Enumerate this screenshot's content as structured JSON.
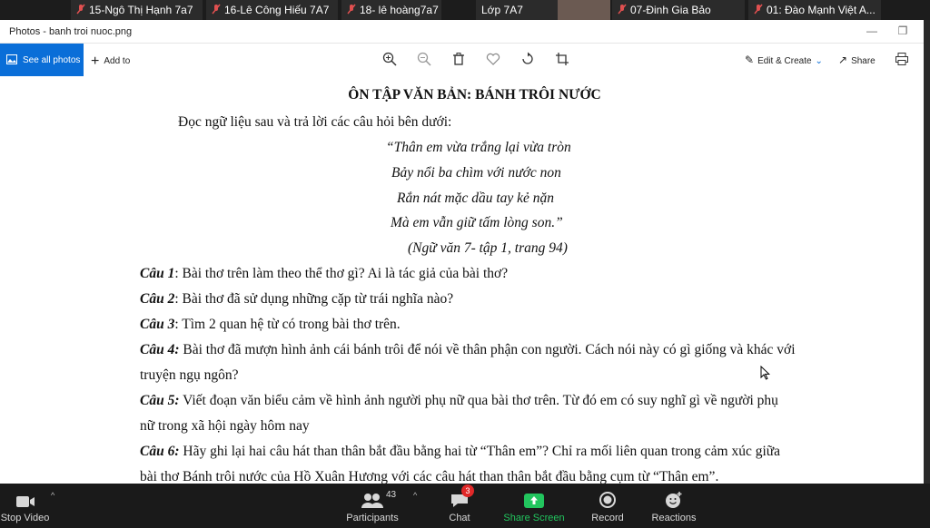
{
  "participants_strip": [
    {
      "name": "15-Ngô Thị Hạnh 7a7",
      "muted": true
    },
    {
      "name": "16-Lê Công Hiếu 7A7",
      "muted": true
    },
    {
      "name": "18- lê hoàng7a7",
      "muted": true
    },
    {
      "name": "Lớp 7A7",
      "muted": false,
      "active": true
    },
    {
      "name": "07-Đinh Gia Bảo",
      "muted": true
    },
    {
      "name": "01: Đào Mạnh Việt A...",
      "muted": true
    }
  ],
  "window": {
    "title": "Photos - banh troi nuoc.png",
    "minimize": "—",
    "restore": "❐"
  },
  "toolbar": {
    "see_all": "See all photos",
    "add_to": "Add to",
    "edit_create": "Edit & Create",
    "share": "Share"
  },
  "document": {
    "title": "ÔN TẬP VĂN BẢN: BÁNH TRÔI NƯỚC",
    "intro": "Đọc ngữ liệu sau và trả lời các câu hỏi bên dưới:",
    "poem": [
      "“Thân em vừa trắng lại vừa tròn",
      "Bảy nổi ba chìm với nước non",
      "Rắn nát mặc dầu tay kẻ nặn",
      "Mà em vẫn giữ tấm lòng son.”",
      "(Ngữ văn 7- tập 1,  trang 94)"
    ],
    "questions": [
      {
        "label": "Câu 1",
        "sep": ": ",
        "lines": [
          "Bài thơ trên làm theo thể thơ gì? Ai là tác giả của bài thơ?"
        ]
      },
      {
        "label": "Câu 2",
        "sep": ": ",
        "lines": [
          "Bài thơ đã sử dụng những cặp từ trái nghĩa nào?"
        ]
      },
      {
        "label": "Câu 3",
        "sep": ": ",
        "lines": [
          "Tìm 2 quan hệ từ có trong bài thơ trên."
        ]
      },
      {
        "label": "Câu 4:",
        "sep": " ",
        "lines": [
          "Bài thơ đã mượn hình ảnh cái bánh trôi để nói về thân phận con người. Cách nói này có gì giống và khác với",
          "truyện ngụ ngôn?"
        ]
      },
      {
        "label": "Câu 5:",
        "sep": " ",
        "lines": [
          "Viết đoạn văn biểu cảm về hình ảnh người phụ nữ qua bài thơ trên. Từ đó em có suy nghĩ gì về người phụ",
          "nữ trong xã hội ngày hôm nay"
        ]
      },
      {
        "label": "Câu 6:",
        "sep": " ",
        "lines": [
          "Hãy ghi lại hai câu hát than thân bắt đầu bằng hai từ “Thân em”? Chỉ ra mối liên quan trong cảm xúc giữa",
          "bài thơ Bánh trôi nước của Hồ Xuân Hương với các câu hát than thân bắt đầu bằng cụm từ “Thân em”."
        ]
      }
    ]
  },
  "bottombar": {
    "stop_video": "Stop Video",
    "participants": "Participants",
    "participants_count": "43",
    "chat": "Chat",
    "chat_badge": "3",
    "share_screen": "Share Screen",
    "record": "Record",
    "reactions": "Reactions"
  },
  "colors": {
    "accent": "#0a6ed8",
    "share_green": "#22c55e",
    "badge_red": "#e02828"
  }
}
